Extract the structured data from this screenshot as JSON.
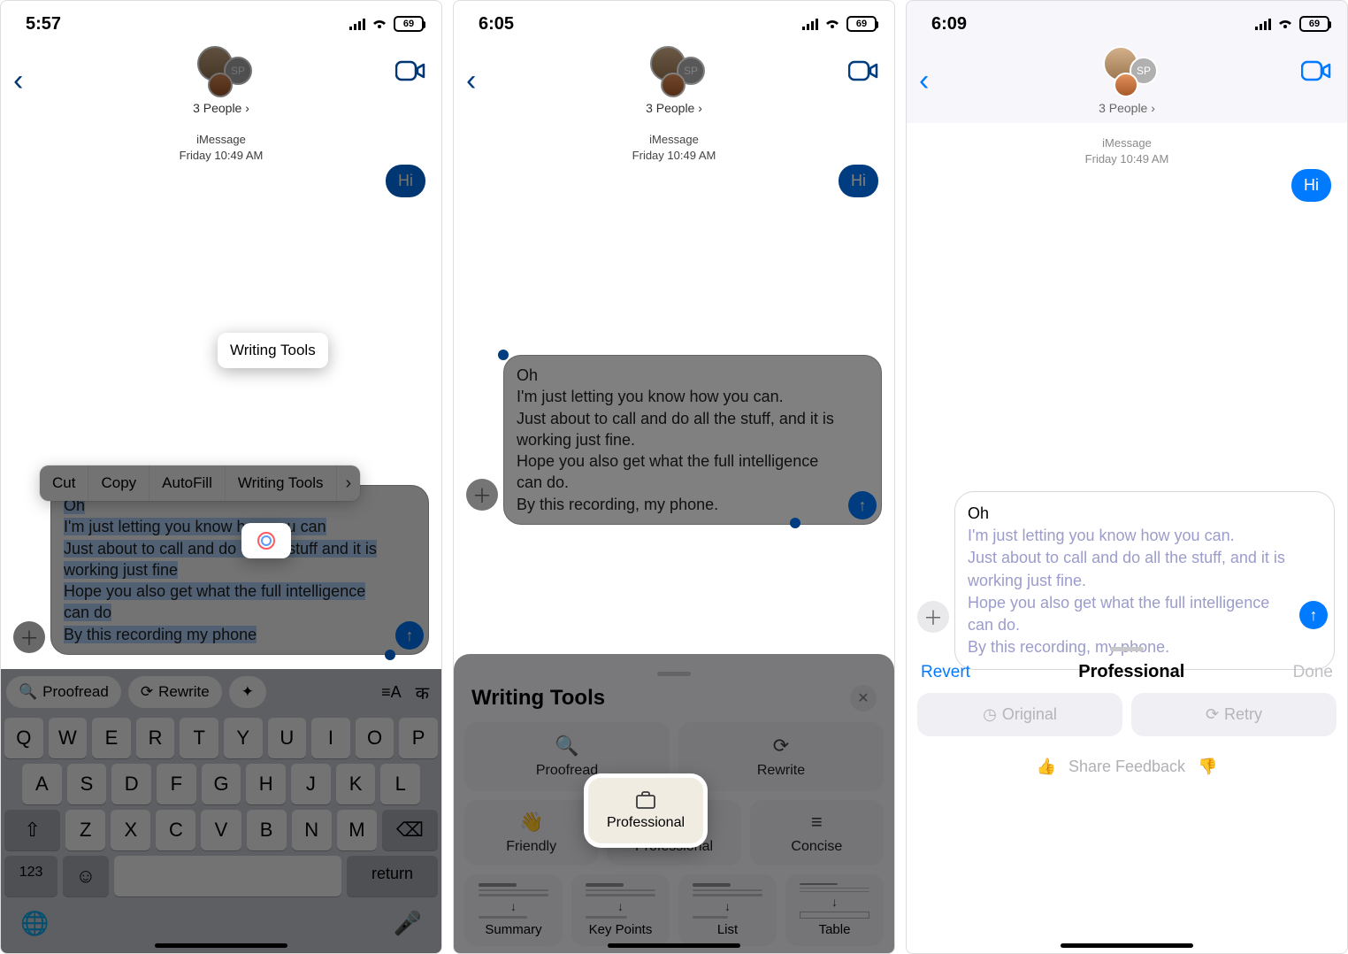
{
  "screens": {
    "s1": {
      "time": "5:57",
      "battery": "69"
    },
    "s2": {
      "time": "6:05",
      "battery": "69"
    },
    "s3": {
      "time": "6:09",
      "battery": "69"
    }
  },
  "conversation": {
    "title_label": "3 People",
    "avatar_initials": "SP",
    "thread_service": "iMessage",
    "thread_timestamp": "Friday 10:49 AM",
    "outgoing_message": "Hi"
  },
  "draft_text_s1": "Oh\nI'm just letting you know how you can\nJust about to call and do all the stuff and it is working just fine\nHope you also get what the full intelligence can do\nBy this recording my phone",
  "draft_text_s2": "Oh\nI'm just letting you know how you can.\nJust about to call and do all the stuff, and it is working just fine.\nHope you also get what the full intelligence can do.\nBy this recording, my phone.",
  "context_menu": {
    "cut": "Cut",
    "copy": "Copy",
    "autofill": "AutoFill",
    "writing_tools": "Writing Tools"
  },
  "suggest": {
    "proofread": "Proofread",
    "rewrite": "Rewrite"
  },
  "keyboard": {
    "row1": [
      "Q",
      "W",
      "E",
      "R",
      "T",
      "Y",
      "U",
      "I",
      "O",
      "P"
    ],
    "row2": [
      "A",
      "S",
      "D",
      "F",
      "G",
      "H",
      "J",
      "K",
      "L"
    ],
    "row3": [
      "Z",
      "X",
      "C",
      "V",
      "B",
      "N",
      "M"
    ],
    "numkey": "123",
    "return": "return"
  },
  "writing_tools": {
    "title": "Writing Tools",
    "proofread": "Proofread",
    "rewrite": "Rewrite",
    "friendly": "Friendly",
    "professional": "Professional",
    "concise": "Concise",
    "summary": "Summary",
    "key_points": "Key Points",
    "list": "List",
    "table": "Table"
  },
  "result_s3": {
    "line1": "Oh",
    "rest": "I'm just letting you know how you can.\nJust about to call and do all the stuff, and it is working just fine.\nHope you also get what the full intelligence can do.\nBy this recording, my phone."
  },
  "s3_bar": {
    "revert": "Revert",
    "title": "Professional",
    "done": "Done",
    "original": "Original",
    "retry": "Retry",
    "feedback": "Share Feedback"
  }
}
